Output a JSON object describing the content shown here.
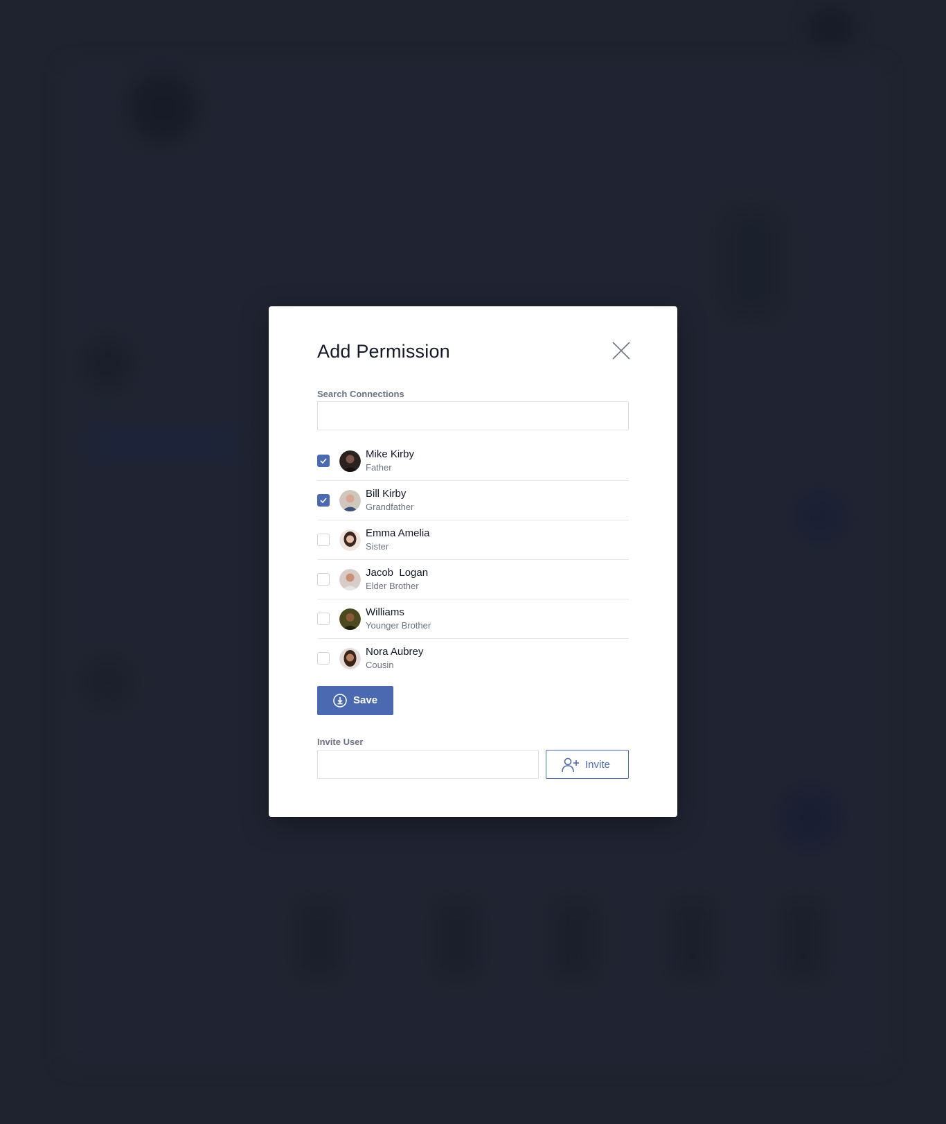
{
  "modal": {
    "title": "Add Permission",
    "close_icon": "close-icon"
  },
  "search": {
    "label": "Search Connections",
    "value": "",
    "placeholder": ""
  },
  "connections": [
    {
      "name": "Mike Kirby",
      "relation": "Father",
      "checked": true,
      "avatar_color": "#2b2220"
    },
    {
      "name": "Bill Kirby",
      "relation": "Grandfather",
      "checked": true,
      "avatar_color": "#b9a89a"
    },
    {
      "name": "Emma Amelia",
      "relation": "Sister",
      "checked": false,
      "avatar_color": "#4a3530"
    },
    {
      "name": "Jacob  Logan",
      "relation": "Elder Brother",
      "checked": false,
      "avatar_color": "#c9b0a3"
    },
    {
      "name": "Williams",
      "relation": "Younger Brother",
      "checked": false,
      "avatar_color": "#4b4a1e"
    },
    {
      "name": "Nora Aubrey",
      "relation": "Cousin",
      "checked": false,
      "avatar_color": "#5a3b2e"
    }
  ],
  "save_button": {
    "label": "Save",
    "icon": "download-circle-icon"
  },
  "invite": {
    "label": "Invite User",
    "value": "",
    "placeholder": "",
    "button_label": "Invite",
    "button_icon": "user-plus-icon"
  },
  "colors": {
    "accent": "#4a69b1",
    "backdrop": "#1f2330",
    "modal_bg": "#ffffff",
    "text_primary": "#121826",
    "text_secondary": "#6b7280"
  }
}
